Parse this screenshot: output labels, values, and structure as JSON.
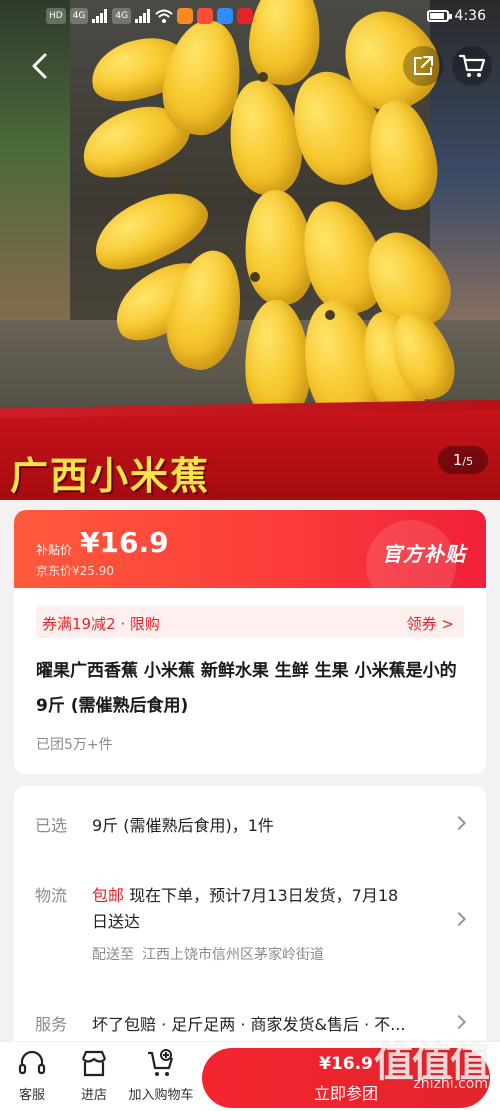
{
  "status": {
    "chips": [
      "HD",
      "4G",
      "HD",
      "4G"
    ],
    "time": "4:36"
  },
  "hero": {
    "title": "广西小米蕉",
    "page_current": "1",
    "page_total": "/5"
  },
  "price": {
    "label": "补贴价",
    "value": "¥16.9",
    "original": "京东价¥25.90",
    "badge": "官方补贴"
  },
  "coupon": {
    "text": "券满19减2 · 限购",
    "action": "领券 >"
  },
  "product": {
    "title": "曜果广西香蕉 小米蕉  新鲜水果 生鲜 生果 小米蕉是小的 9斤 (需催熟后食用)",
    "sold": "已团5万+件"
  },
  "details": {
    "selected_label": "已选",
    "selected_value": "9斤 (需催熟后食用)，1件",
    "logistics_label": "物流",
    "logistics_tag": "包邮",
    "logistics_value_line1": "现在下单，预计7月13日发货，7月18",
    "logistics_value_line2": "日送达",
    "ship_to_label": "配送至",
    "ship_to_addr": "江西上饶市信州区茅家岭街道",
    "service_label": "服务",
    "service_value": "坏了包赔 · 足斤足两 · 商家发货&售后 · 不..."
  },
  "bottom": {
    "service": "客服",
    "store": "进店",
    "add_cart": "加入购物车",
    "buy_price": "¥16.9",
    "buy_label": "立即参团"
  },
  "watermark": {
    "main": "值值值",
    "sub": "zhizhi.com"
  },
  "colors": {
    "accent": "#e4242c",
    "banner_title": "#ffe44a"
  }
}
